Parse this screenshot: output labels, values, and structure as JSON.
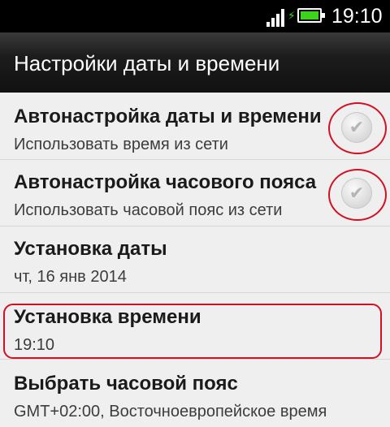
{
  "status_bar": {
    "signal_icon": "signal-bars-icon",
    "battery_icon": "battery-charging-icon",
    "time": "19:10"
  },
  "header": {
    "title": "Настройки даты и времени"
  },
  "settings": {
    "auto_datetime": {
      "title": "Автонастройка даты и времени",
      "subtitle": "Использовать время из сети",
      "checked": true
    },
    "auto_timezone": {
      "title": "Автонастройка часового пояса",
      "subtitle": "Использовать часовой пояс из сети",
      "checked": true
    },
    "set_date": {
      "title": "Установка даты",
      "value": "чт, 16 янв 2014"
    },
    "set_time": {
      "title": "Установка времени",
      "value": "19:10"
    },
    "select_timezone": {
      "title": "Выбрать часовой пояс",
      "value": "GMT+02:00, Восточноевропейское время"
    }
  },
  "colors": {
    "annotation_red": "#d20f23",
    "battery_green": "#3cd31c"
  }
}
